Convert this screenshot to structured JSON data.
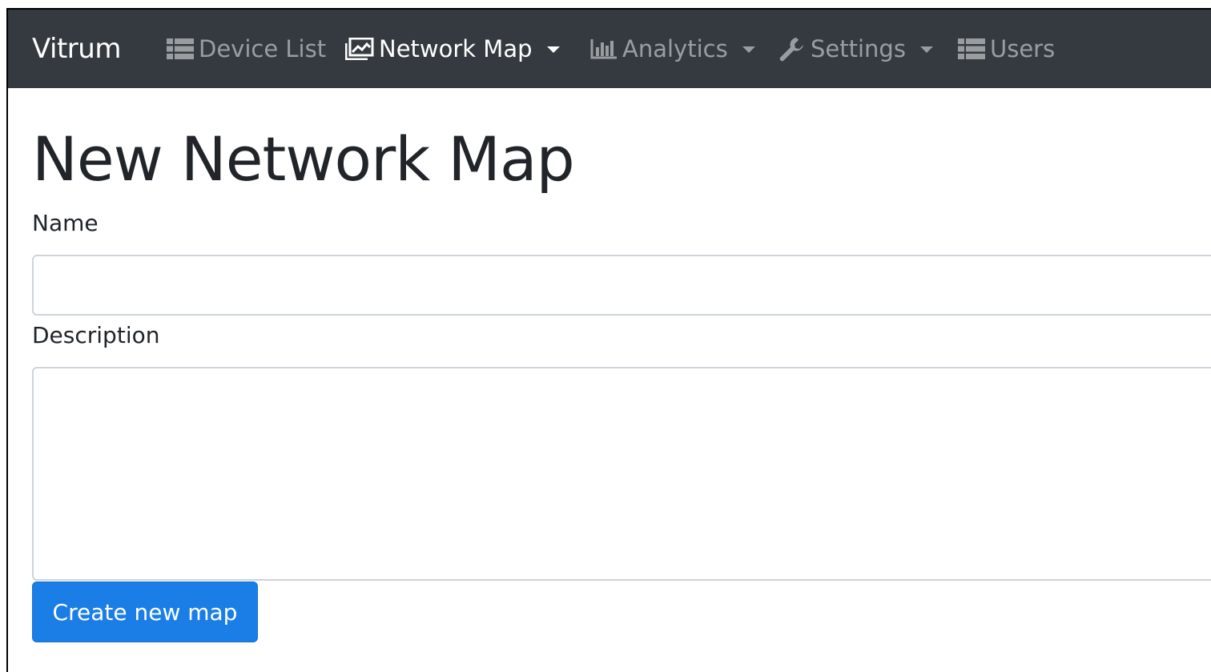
{
  "navbar": {
    "brand": "Vitrum",
    "items": [
      {
        "label": "Device List",
        "icon": "list-icon",
        "dropdown": false,
        "active": false
      },
      {
        "label": "Network Map",
        "icon": "image-icon",
        "dropdown": true,
        "active": true
      },
      {
        "label": "Analytics",
        "icon": "bar-chart-icon",
        "dropdown": true,
        "active": false
      },
      {
        "label": "Settings",
        "icon": "wrench-icon",
        "dropdown": true,
        "active": false
      },
      {
        "label": "Users",
        "icon": "list-icon",
        "dropdown": false,
        "active": false
      }
    ]
  },
  "main": {
    "title": "New Network Map",
    "name_label": "Name",
    "name_value": "",
    "description_label": "Description",
    "description_value": "",
    "submit_label": "Create new map"
  },
  "colors": {
    "navbar_bg": "#343a40",
    "primary": "#1a7ee6"
  }
}
